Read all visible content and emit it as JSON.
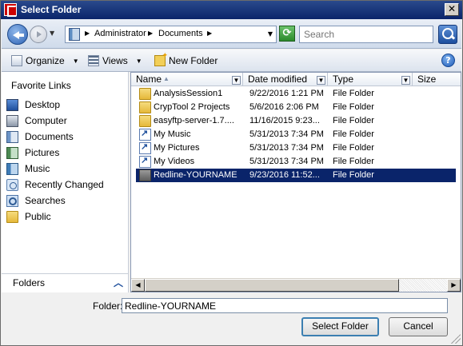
{
  "window": {
    "title": "Select Folder",
    "close_glyph": "✕"
  },
  "navbar": {
    "address": [
      "Administrator",
      "Documents"
    ],
    "search_placeholder": "Search"
  },
  "toolbar": {
    "organize": "Organize",
    "views": "Views",
    "new_folder": "New Folder",
    "help_glyph": "?"
  },
  "sidebar": {
    "title": "Favorite Links",
    "items": [
      {
        "label": "Desktop",
        "icon": "desktop-icon"
      },
      {
        "label": "Computer",
        "icon": "computer-icon"
      },
      {
        "label": "Documents",
        "icon": "documents-icon"
      },
      {
        "label": "Pictures",
        "icon": "pictures-icon"
      },
      {
        "label": "Music",
        "icon": "music-icon"
      },
      {
        "label": "Recently Changed",
        "icon": "recent-icon"
      },
      {
        "label": "Searches",
        "icon": "searches-icon"
      },
      {
        "label": "Public",
        "icon": "folder-icon"
      }
    ],
    "folders_label": "Folders"
  },
  "columns": {
    "name": "Name",
    "date": "Date modified",
    "type": "Type",
    "size": "Size"
  },
  "files": [
    {
      "name": "AnalysisSession1",
      "date": "9/22/2016 1:21 PM",
      "type": "File Folder",
      "icon": "folder-icon"
    },
    {
      "name": "CrypTool 2 Projects",
      "date": "5/6/2016 2:06 PM",
      "type": "File Folder",
      "icon": "folder-icon"
    },
    {
      "name": "easyftp-server-1.7....",
      "date": "11/16/2015 9:23...",
      "type": "File Folder",
      "icon": "folder-icon"
    },
    {
      "name": "My Music",
      "date": "5/31/2013 7:34 PM",
      "type": "File Folder",
      "icon": "shortcut-icon"
    },
    {
      "name": "My Pictures",
      "date": "5/31/2013 7:34 PM",
      "type": "File Folder",
      "icon": "shortcut-icon"
    },
    {
      "name": "My Videos",
      "date": "5/31/2013 7:34 PM",
      "type": "File Folder",
      "icon": "shortcut-icon"
    },
    {
      "name": "Redline-YOURNAME",
      "date": "9/23/2016 11:52...",
      "type": "File Folder",
      "icon": "folder-icon",
      "selected": true
    }
  ],
  "footer": {
    "folder_label": "Folder:",
    "folder_value": "Redline-YOURNAME",
    "select_button": "Select Folder",
    "cancel_button": "Cancel"
  }
}
